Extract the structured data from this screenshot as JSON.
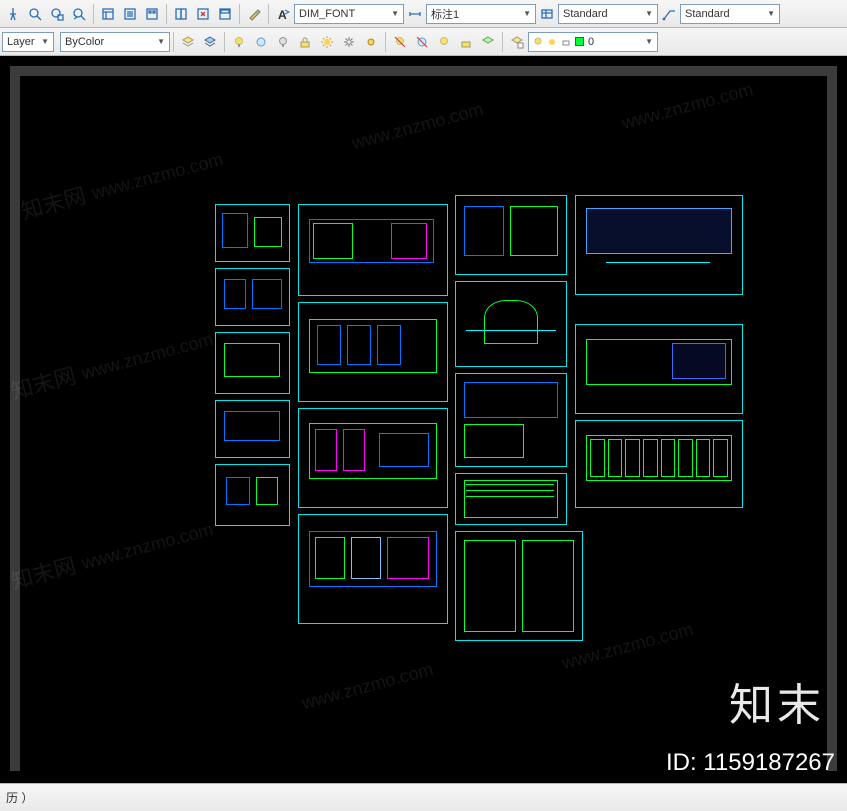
{
  "toolbar1": {
    "font_style_label": "DIM_FONT",
    "dim_style_label": "标注1",
    "text_style_label": "Standard",
    "table_style_label": "Standard"
  },
  "toolbar2": {
    "layer_dropdown_label": "Layer",
    "color_dropdown_label": "ByColor",
    "layer0_label": "0"
  },
  "statusbar": {
    "text": "历 ）"
  },
  "watermark": {
    "site_en": "www.znzmo.com",
    "site_cn": "知末网",
    "brand_big": "知末",
    "id_label": "ID: 1159187267"
  },
  "colors": {
    "cyan": "#00e6e6",
    "green": "#00ff33",
    "blue": "#0077ff",
    "magenta": "#ff00ff"
  }
}
